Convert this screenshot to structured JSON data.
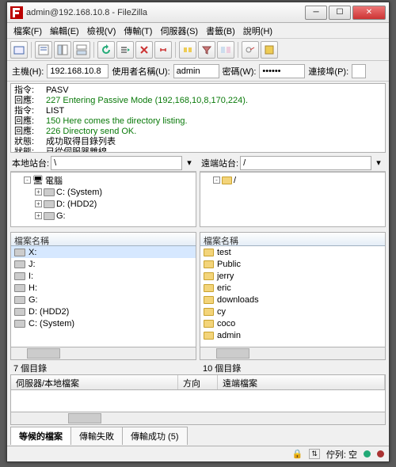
{
  "title": "admin@192.168.10.8 - FileZilla",
  "menus": [
    "檔案(F)",
    "編輯(E)",
    "檢視(V)",
    "傳輸(T)",
    "伺服器(S)",
    "書籤(B)",
    "說明(H)"
  ],
  "conn": {
    "host_label": "主機(H):",
    "host": "192.168.10.8",
    "user_label": "使用者名稱(U):",
    "user": "admin",
    "pass_label": "密碼(W):",
    "pass": "••••••",
    "port_label": "連接埠(P):",
    "port": ""
  },
  "log": [
    {
      "lbl": "指令:",
      "msg": "PASV",
      "cls": "normal"
    },
    {
      "lbl": "回應:",
      "msg": "227 Entering Passive Mode (192,168,10,8,170,224).",
      "cls": "green"
    },
    {
      "lbl": "指令:",
      "msg": "LIST",
      "cls": "normal"
    },
    {
      "lbl": "回應:",
      "msg": "150 Here comes the directory listing.",
      "cls": "green"
    },
    {
      "lbl": "回應:",
      "msg": "226 Directory send OK.",
      "cls": "green"
    },
    {
      "lbl": "狀態:",
      "msg": "成功取得目錄列表",
      "cls": "normal"
    },
    {
      "lbl": "狀態:",
      "msg": "已從伺服器離線",
      "cls": "normal"
    }
  ],
  "local": {
    "site_label": "本地站台:",
    "path": "\\",
    "tree": [
      {
        "indent": "indent1",
        "sq": "-",
        "icon": "computer",
        "label": "電腦"
      },
      {
        "indent": "indent2",
        "sq": "+",
        "icon": "disk",
        "label": "C: (System)"
      },
      {
        "indent": "indent2",
        "sq": "+",
        "icon": "disk",
        "label": "D: (HDD2)"
      },
      {
        "indent": "indent2",
        "sq": "+",
        "icon": "disk",
        "label": "G:"
      }
    ],
    "list_head": "檔案名稱",
    "files": [
      "X:",
      "J:",
      "I:",
      "H:",
      "G:",
      "D: (HDD2)",
      "C: (System)"
    ],
    "count": "7 個目錄"
  },
  "remote": {
    "site_label": "遠端站台:",
    "path": "/",
    "tree": [
      {
        "indent": "indent1",
        "sq": "-",
        "icon": "folder",
        "label": "/"
      }
    ],
    "list_head": "檔案名稱",
    "files": [
      "test",
      "Public",
      "jerry",
      "eric",
      "downloads",
      "cy",
      "coco",
      "admin"
    ],
    "count": "10 個目錄"
  },
  "queue_cols": {
    "c1": "伺服器/本地檔案",
    "c2": "方向",
    "c3": "遠端檔案"
  },
  "tabs": {
    "t1": "等候的檔案",
    "t2": "傳輸失敗",
    "t3": "傳輸成功 (5)"
  },
  "status": {
    "queue": "佇列: 空"
  }
}
